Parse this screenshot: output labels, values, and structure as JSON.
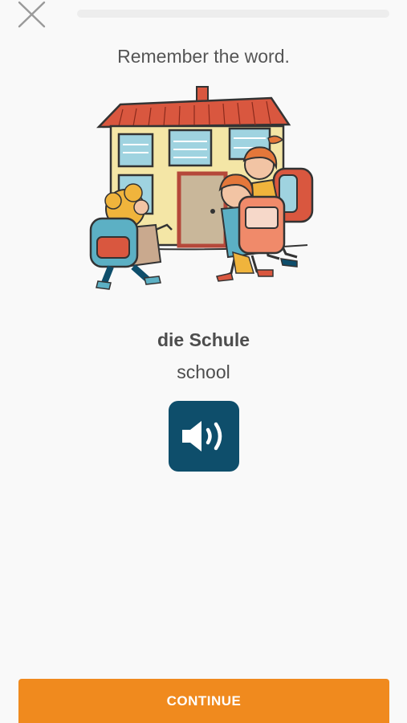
{
  "header": {
    "close_icon": "close-icon",
    "progress": 0
  },
  "lesson": {
    "instruction": "Remember the word.",
    "illustration": "school-illustration",
    "word": "die Schule",
    "translation": "school",
    "audio_icon": "speaker-icon"
  },
  "footer": {
    "continue_label": "CONTINUE"
  },
  "colors": {
    "accent": "#f08a1e",
    "audio_button": "#0e4e6b",
    "text": "#4d4d4d",
    "background": "#f9f9f9"
  }
}
